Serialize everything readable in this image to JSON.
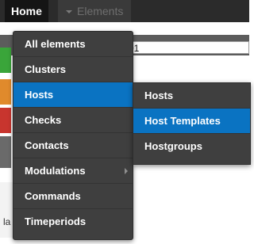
{
  "navbar": {
    "home_label": "Home",
    "elements_label": "Elements"
  },
  "background": {
    "input_value": "01",
    "partial_text": "la"
  },
  "menu": {
    "items": [
      {
        "label": "All elements",
        "active": false
      },
      {
        "label": "Clusters",
        "active": false
      },
      {
        "label": "Hosts",
        "active": true
      },
      {
        "label": "Checks",
        "active": false
      },
      {
        "label": "Contacts",
        "active": false
      },
      {
        "label": "Modulations",
        "active": false
      },
      {
        "label": "Commands",
        "active": false
      },
      {
        "label": "Timeperiods",
        "active": false
      }
    ]
  },
  "submenu": {
    "items": [
      {
        "label": "Hosts",
        "active": false
      },
      {
        "label": "Host Templates",
        "active": true
      },
      {
        "label": "Hostgroups",
        "active": false
      }
    ]
  },
  "colors": {
    "navbar_bg": "#2b2b2b",
    "menu_bg": "#3f3f3f",
    "active_bg": "#0a73c2",
    "text": "#ffffff"
  }
}
